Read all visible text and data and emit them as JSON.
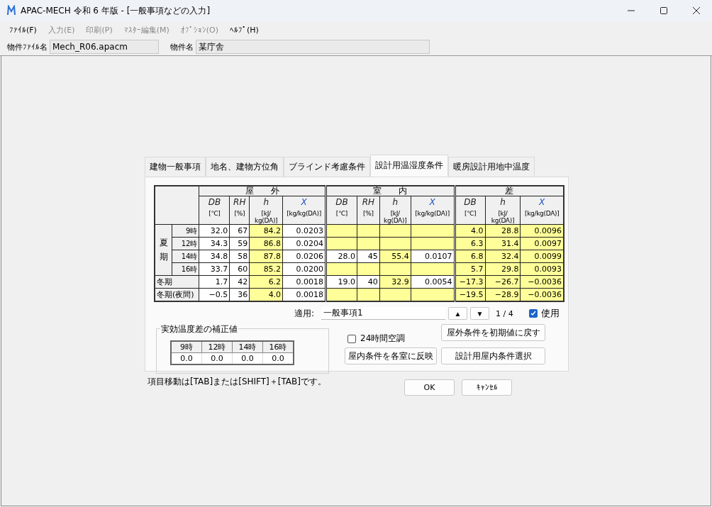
{
  "window": {
    "title": "APAC-MECH 令和 6 年版 - [一般事項などの入力]"
  },
  "menu": [
    {
      "label": "ﾌｧｲﾙ(F)",
      "disabled": false
    },
    {
      "label": "入力(E)",
      "disabled": true
    },
    {
      "label": "印刷(P)",
      "disabled": true
    },
    {
      "label": "ﾏｽﾀｰ編集(M)",
      "disabled": true
    },
    {
      "label": "ｵﾌﾟｼｮﾝ(O)",
      "disabled": true
    },
    {
      "label": "ﾍﾙﾌﾟ(H)",
      "disabled": false
    }
  ],
  "project": {
    "file_label": "物件ﾌｧｲﾙ名",
    "file_value": "Mech_R06.apacm",
    "name_label": "物件名",
    "name_value": "某庁舎"
  },
  "tabs": [
    {
      "label": "建物一般事項",
      "selected": false
    },
    {
      "label": "地名、建物方位角",
      "selected": false
    },
    {
      "label": "ブラインド考慮条件",
      "selected": false
    },
    {
      "label": "設計用温湿度条件",
      "selected": true
    },
    {
      "label": "暖房設計用地中温度",
      "selected": false
    }
  ],
  "table": {
    "groups": [
      {
        "label": "屋　　外",
        "columns": [
          {
            "symbol": "DB",
            "unit": "[℃]"
          },
          {
            "symbol": "RH",
            "unit": "[%]"
          },
          {
            "symbol": "h",
            "unit": "[kJ/\nkg(DA)]"
          },
          {
            "symbol": "X",
            "unit": "[kg/kg(DA)]"
          }
        ]
      },
      {
        "label": "室　　内",
        "columns": [
          {
            "symbol": "DB",
            "unit": "[℃]"
          },
          {
            "symbol": "RH",
            "unit": "[%]"
          },
          {
            "symbol": "h",
            "unit": "[kJ/\nkg(DA)]"
          },
          {
            "symbol": "X",
            "unit": "[kg/kg(DA)]"
          }
        ]
      },
      {
        "label": "差",
        "columns": [
          {
            "symbol": "DB",
            "unit": "[℃]"
          },
          {
            "symbol": "h",
            "unit": "[kJ/\nkg(DA)]"
          },
          {
            "symbol": "X",
            "unit": "[kg/kg(DA)]"
          }
        ]
      }
    ],
    "rows": [
      {
        "kind": "group",
        "label": "夏期",
        "children": [
          {
            "label": "9時",
            "cells": [
              {
                "text": "32.0",
                "editable": true
              },
              {
                "text": "67",
                "editable": true
              },
              {
                "text": "84.2",
                "editable": false
              },
              {
                "text": "0.0203",
                "editable": true
              },
              {
                "editable": false
              },
              {
                "editable": false
              },
              {
                "editable": false
              },
              {
                "editable": false
              },
              {
                "text": "4.0",
                "editable": false
              },
              {
                "text": "28.8",
                "editable": false
              },
              {
                "text": "0.0096",
                "editable": false
              }
            ]
          },
          {
            "label": "12時",
            "cells": [
              {
                "text": "34.3",
                "editable": true
              },
              {
                "text": "59",
                "editable": true
              },
              {
                "text": "86.8",
                "editable": false
              },
              {
                "text": "0.0204",
                "editable": true
              },
              {
                "editable": false
              },
              {
                "editable": false
              },
              {
                "editable": false
              },
              {
                "editable": false
              },
              {
                "text": "6.3",
                "editable": false
              },
              {
                "text": "31.4",
                "editable": false
              },
              {
                "text": "0.0097",
                "editable": false
              }
            ]
          },
          {
            "label": "14時",
            "cells": [
              {
                "text": "34.8",
                "editable": true
              },
              {
                "text": "58",
                "editable": true
              },
              {
                "text": "87.8",
                "editable": false
              },
              {
                "text": "0.0206",
                "editable": true
              },
              {
                "text": "28.0",
                "editable": true
              },
              {
                "text": "45",
                "editable": true
              },
              {
                "text": "55.4",
                "editable": false
              },
              {
                "text": "0.0107",
                "editable": true
              },
              {
                "text": "6.8",
                "editable": false
              },
              {
                "text": "32.4",
                "editable": false
              },
              {
                "text": "0.0099",
                "editable": false
              }
            ]
          },
          {
            "label": "16時",
            "cells": [
              {
                "text": "33.7",
                "editable": true
              },
              {
                "text": "60",
                "editable": true
              },
              {
                "text": "85.2",
                "editable": false
              },
              {
                "text": "0.0200",
                "editable": true
              },
              {
                "editable": false
              },
              {
                "editable": false
              },
              {
                "editable": false
              },
              {
                "editable": false
              },
              {
                "text": "5.7",
                "editable": false
              },
              {
                "text": "29.8",
                "editable": false
              },
              {
                "text": "0.0093",
                "editable": false
              }
            ]
          }
        ]
      },
      {
        "kind": "single",
        "label": "冬期",
        "cells": [
          {
            "text": "1.7",
            "editable": true
          },
          {
            "text": "42",
            "editable": true
          },
          {
            "text": "6.2",
            "editable": false
          },
          {
            "text": "0.0018",
            "editable": true
          },
          {
            "text": "19.0",
            "editable": true
          },
          {
            "text": "40",
            "editable": true
          },
          {
            "text": "32.9",
            "editable": false
          },
          {
            "text": "0.0054",
            "editable": true
          },
          {
            "text": "−17.3",
            "editable": false
          },
          {
            "text": "−26.7",
            "editable": false
          },
          {
            "text": "−0.0036",
            "editable": false
          }
        ]
      },
      {
        "kind": "single",
        "label": "冬期(夜間)",
        "cells": [
          {
            "text": "−0.5",
            "editable": true
          },
          {
            "text": "36",
            "editable": true
          },
          {
            "text": "4.0",
            "editable": false
          },
          {
            "text": "0.0018",
            "editable": true
          },
          {
            "editable": false
          },
          {
            "editable": false
          },
          {
            "editable": false
          },
          {
            "editable": false
          },
          {
            "text": "−19.5",
            "editable": false
          },
          {
            "text": "−28.9",
            "editable": false
          },
          {
            "text": "−0.0036",
            "editable": false
          }
        ]
      }
    ]
  },
  "apply": {
    "label": "適用:",
    "value": "一般事項1",
    "up": "▲",
    "down": "▼",
    "page": "1 / 4",
    "use_label": "使用",
    "use_checked": true
  },
  "correction": {
    "title": "実効温度差の補正値",
    "columns": [
      "9時",
      "12時",
      "14時",
      "16時"
    ],
    "values": [
      "0.0",
      "0.0",
      "0.0",
      "0.0"
    ]
  },
  "hvac24": {
    "label": "24時間空調",
    "checked": false
  },
  "actions": [
    "屋外条件を初期値に戻す",
    "屋内条件を各室に反映",
    "設計用屋内条件選択"
  ],
  "hint": "項目移動は[TAB]または[SHIFT]＋[TAB]です。",
  "buttons": [
    "OK",
    "ｷｬﾝｾﾙ"
  ]
}
